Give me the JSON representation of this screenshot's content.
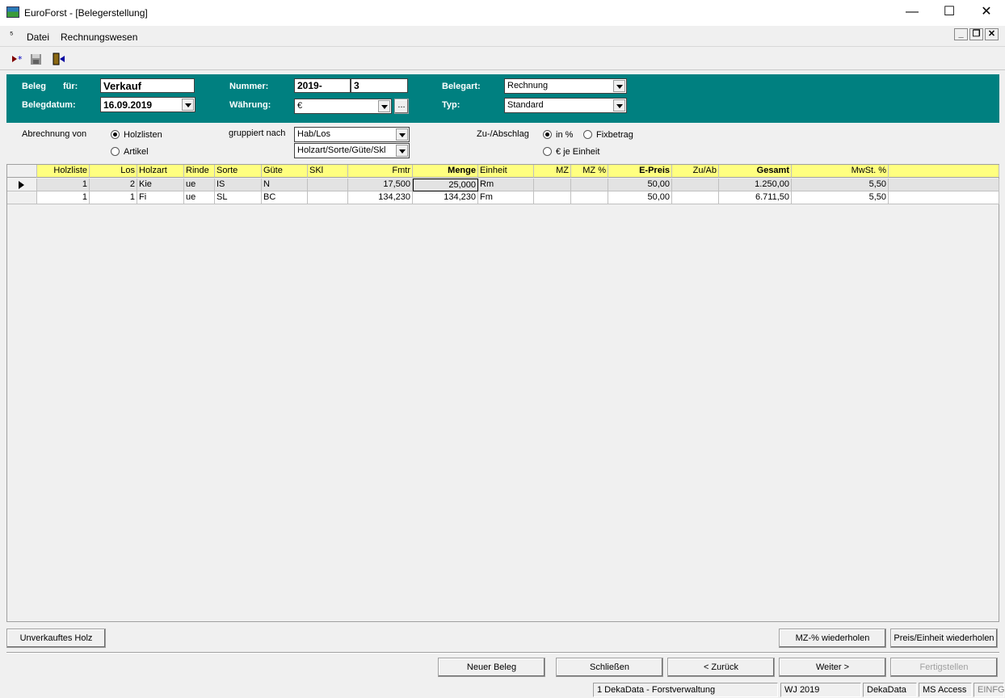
{
  "window": {
    "title": "EuroForst - [Belegerstellung]",
    "minimize": "—",
    "maximize": "☐",
    "close": "✕"
  },
  "menu": {
    "datei": "Datei",
    "rechnungswesen": "Rechnungswesen"
  },
  "mdi_controls": {
    "min": "_",
    "restore": "❐",
    "close": "✕"
  },
  "toolbar": {
    "icons": [
      "new-record-icon",
      "save-icon",
      "exit-icon"
    ]
  },
  "header": {
    "beleg_label": "Beleg",
    "fuer_label": "für:",
    "fuer_value": "Verkauf",
    "belegdatum_label": "Belegdatum:",
    "belegdatum_value": "16.09.2019",
    "nummer_label": "Nummer:",
    "nummer_prefix": "2019-",
    "nummer_value": "3",
    "waehrung_label": "Währung:",
    "waehrung_value": "€",
    "waehrung_more": "...",
    "belegart_label": "Belegart:",
    "belegart_value": "Rechnung",
    "typ_label": "Typ:",
    "typ_value": "Standard"
  },
  "options": {
    "abrechnung_label": "Abrechnung von",
    "holzlisten": "Holzlisten",
    "artikel": "Artikel",
    "gruppiert_label": "gruppiert nach",
    "gruppe1": "Hab/Los",
    "gruppe2": "Holzart/Sorte/Güte/Skl",
    "zuabschlag_label": "Zu-/Abschlag",
    "in_prozent": "in %",
    "fixbetrag": "Fixbetrag",
    "euro_je_einheit": "€ je Einheit"
  },
  "grid": {
    "columns": [
      "Holzliste",
      "Los",
      "Holzart",
      "Rinde",
      "Sorte",
      "Güte",
      "SKl",
      "Fmtr",
      "Menge",
      "Einheit",
      "MZ",
      "MZ %",
      "E-Preis",
      "Zu/Ab",
      "Gesamt",
      "MwSt. %"
    ],
    "rows": [
      [
        "1",
        "2",
        "Kie",
        "ue",
        "IS",
        "N",
        "",
        "17,500",
        "25,000",
        "Rm",
        "",
        "",
        "50,00",
        "",
        "1.250,00",
        "5,50"
      ],
      [
        "1",
        "1",
        "Fi",
        "ue",
        "SL",
        "BC",
        "",
        "134,230",
        "134,230",
        "Fm",
        "",
        "",
        "50,00",
        "",
        "6.711,50",
        "5,50"
      ]
    ]
  },
  "buttons": {
    "unverkauftes_holz": "Unverkauftes Holz",
    "mz_wiederholen": "MZ-% wiederholen",
    "preis_wiederholen": "Preis/Einheit wiederholen",
    "neuer_beleg": "Neuer Beleg",
    "schliessen": "Schließen",
    "zurueck": "< Zurück",
    "weiter": "Weiter >",
    "fertigstellen": "Fertigstellen"
  },
  "status": {
    "db": "1 DekaData - Forstverwaltung",
    "wj": "WJ 2019",
    "company": "DekaData",
    "access": "MS Access",
    "mode": "EINFG"
  }
}
